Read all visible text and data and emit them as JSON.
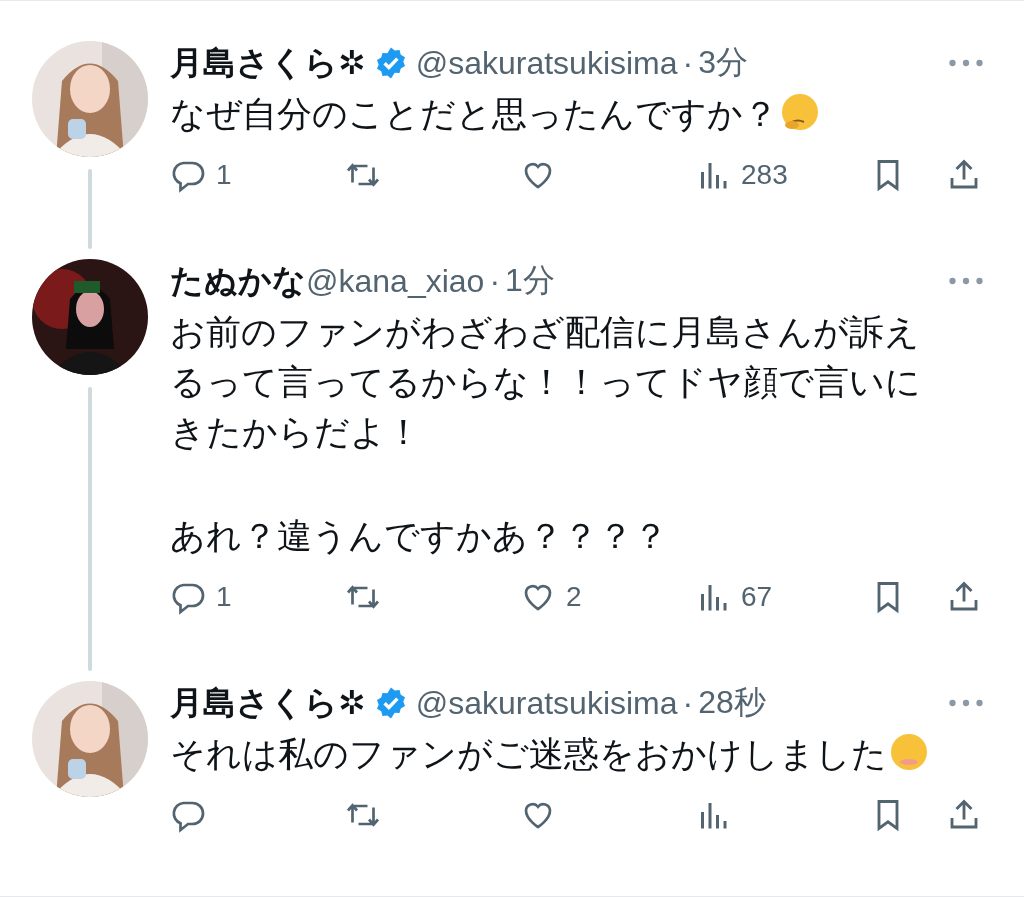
{
  "tweets": [
    {
      "name": "月島さくら✲",
      "verified": true,
      "handle": "@sakuratsukisima",
      "separator": "·",
      "time": "3分",
      "paragraphs": [
        "なぜ自分のことだと思ったんですか？"
      ],
      "replies": "1",
      "views": "283"
    },
    {
      "name": "たぬかな",
      "verified": false,
      "handle": "@kana_xiao",
      "separator": "·",
      "time": "1分",
      "paragraphs": [
        "お前のファンがわざわざ配信に月島さんが訴えるって言ってるからな！！ってドヤ顔で言いにきたからだよ！",
        "あれ？違うんですかあ？？？？"
      ],
      "replies": "1",
      "likes": "2",
      "views": "67"
    },
    {
      "name": "月島さくら✲",
      "verified": true,
      "handle": "@sakuratsukisima",
      "separator": "·",
      "time": "28秒",
      "paragraphs": [
        "それは私のファンがご迷惑をおかけしました"
      ]
    }
  ]
}
